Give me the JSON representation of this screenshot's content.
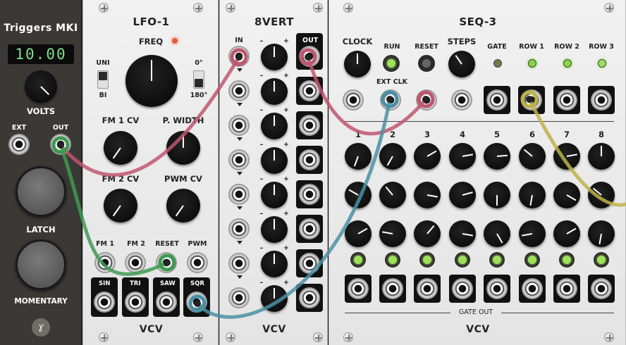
{
  "triggers": {
    "title": "Triggers MKI",
    "display": "10.00",
    "volts_label": "VOLTS",
    "ext_label": "EXT",
    "out_label": "OUT",
    "latch_label": "LATCH",
    "momentary_label": "MOMENTARY"
  },
  "lfo": {
    "title": "LFO-1",
    "freq_label": "FREQ",
    "uni_label": "UNI",
    "bi_label": "BI",
    "deg0_label": "0°",
    "deg180_label": "180°",
    "fm1cv_label": "FM 1 CV",
    "pwidth_label": "P. WIDTH",
    "fm2cv_label": "FM 2 CV",
    "pwmcv_label": "PWM CV",
    "fm1_label": "FM 1",
    "fm2_label": "FM 2",
    "reset_label": "RESET",
    "pwm_label": "PWM",
    "sin_label": "SIN",
    "tri_label": "TRI",
    "saw_label": "SAW",
    "sqr_label": "SQR",
    "brand": "VCV"
  },
  "vert": {
    "title": "8VERT",
    "in_label": "IN",
    "out_label": "OUT",
    "minus": "–",
    "plus": "+",
    "brand": "VCV"
  },
  "seq": {
    "title": "SEQ-3",
    "clock_label": "CLOCK",
    "run_label": "RUN",
    "reset_label": "RESET",
    "steps_label": "STEPS",
    "ext_clk_label": "EXT CLK",
    "gate_label": "GATE",
    "row1_label": "ROW 1",
    "row2_label": "ROW 2",
    "row3_label": "ROW 3",
    "steps": [
      "1",
      "2",
      "3",
      "4",
      "5",
      "6",
      "7",
      "8"
    ],
    "gate_out_label": "GATE OUT",
    "brand": "VCV"
  },
  "colors": {
    "cable_red": "#c0566e",
    "cable_green": "#3f9a52",
    "cable_blue": "#4b90a6",
    "cable_yellow": "#bdb14a",
    "led_green": "#86d640",
    "led_red": "#e04a3a"
  }
}
